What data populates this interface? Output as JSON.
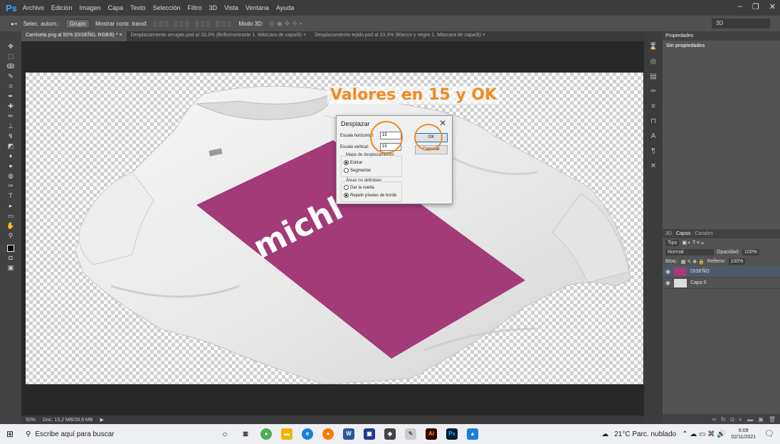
{
  "app": {
    "logo": "Ps"
  },
  "menu": [
    "Archivo",
    "Edición",
    "Imagen",
    "Capa",
    "Texto",
    "Selección",
    "Filtro",
    "3D",
    "Vista",
    "Ventana",
    "Ayuda"
  ],
  "window_controls": [
    "–",
    "❐",
    "✕"
  ],
  "options_bar": {
    "auto_select_label": "Selec. autom.:",
    "group_value": "Grupo",
    "show_transform_label": "Mostrar contr. transf.",
    "mode_3d_label": "Modo 3D:",
    "workspace": "3D"
  },
  "tabs": [
    "Camiseta.png al 50% (DISEÑO, RGB/8) * ×",
    "Desplazamiento arrugas.psd al 33,3% (Brillo/contraste 1, Máscara de capa/8) ×",
    "Desplazamiento tejido.psd al 33,3% (Blanco y negro 1, Máscara de capa/8) ×"
  ],
  "annotation": "Valores en 15 y OK",
  "design_text": "michl",
  "dialog": {
    "title": "Desplazar",
    "close": "✕",
    "h_label": "Escala horizontal:",
    "h_value": "15",
    "v_label": "Escala vertical:",
    "v_value": "15",
    "ok": "OK",
    "cancel": "Cancelar",
    "map_group": "Mapa de desplazamiento:",
    "map_opt1": "Estirar",
    "map_opt2": "Segmentar",
    "undef_group": "Áreas no definidas:",
    "undef_opt1": "Dar la vuelta",
    "undef_opt2": "Repetir píxeles de borde"
  },
  "status": {
    "zoom": "50%",
    "doc": "Doc: 13,2 MB/28,9 MB"
  },
  "properties": {
    "tab": "Propiedades",
    "text": "Sin propiedades"
  },
  "layers": {
    "tabs": [
      "3D",
      "Capas",
      "Canales"
    ],
    "kind": "Tipo",
    "blend": "Normal",
    "opacity_label": "Opacidad:",
    "opacity": "100%",
    "lock_label": "Bloq.:",
    "fill_label": "Relleno:",
    "fill": "100%",
    "items": [
      "DISEÑO",
      "Capa 0"
    ]
  },
  "taskbar": {
    "search_placeholder": "Escribe aquí para buscar",
    "weather": "21°C  Parc. nublado",
    "time": "6:09",
    "date": "02/11/2021",
    "notif_count": "2"
  },
  "colors": {
    "accent": "#ef8a22",
    "magenta": "#a23b78",
    "ps_blue": "#31a8ff"
  }
}
